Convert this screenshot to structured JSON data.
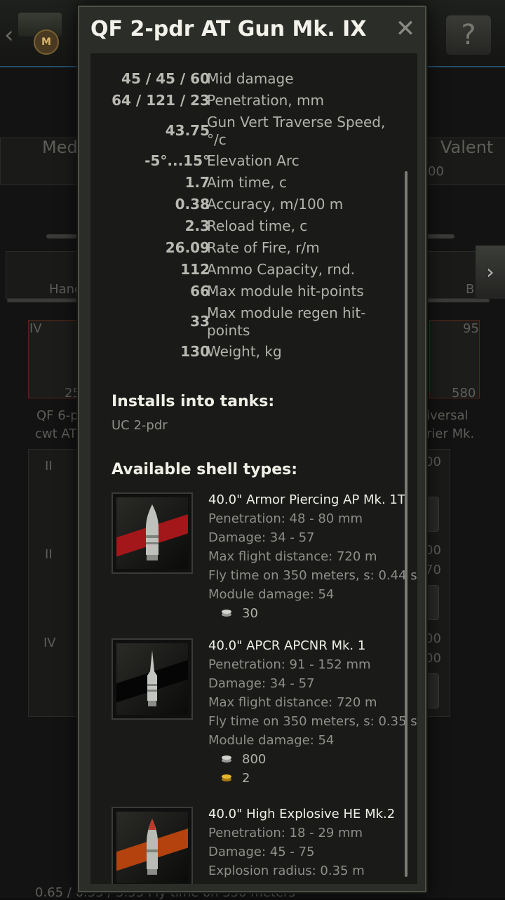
{
  "background": {
    "left_tab_label": "Med",
    "right_tab_label": "Valent",
    "right_tab_sub": "00",
    "hangar_label": "Hang",
    "right_menu_label": "B",
    "left_item_tier": "IV",
    "left_item_price": "25",
    "right_item_stars": "95",
    "right_item_price": "580",
    "left_item_name_1": "QF 6-p",
    "left_item_name_2": "cwt AT",
    "right_item_name_1": "iversal",
    "right_item_name_2": "rier Mk.",
    "row_tiers": [
      "II",
      "II",
      "IV"
    ],
    "right_nums": [
      "00",
      "00",
      "70",
      "00",
      "00"
    ],
    "bottom_text": "0.65 / 0.55 / 5.55   Fly time on 350 meters"
  },
  "dialog": {
    "title": "QF 2-pdr AT Gun Mk. IX",
    "close_icon": "close-x-icon",
    "stats": [
      {
        "value": "45 / 45 / 60",
        "label": "Mid damage"
      },
      {
        "value": "64 / 121 / 23",
        "label": "Penetration, mm"
      },
      {
        "value": "43.75",
        "label": "Gun Vert Traverse Speed, °/c"
      },
      {
        "value": "-5°...15°",
        "label": "Elevation Arc"
      },
      {
        "value": "1.7",
        "label": "Aim time, c"
      },
      {
        "value": "0.38",
        "label": "Accuracy, m/100 m"
      },
      {
        "value": "2.3",
        "label": "Reload time, c"
      },
      {
        "value": "26.09",
        "label": "Rate of Fire, r/m"
      },
      {
        "value": "112",
        "label": "Ammo Capacity, rnd."
      },
      {
        "value": "66",
        "label": "Max module hit-points"
      },
      {
        "value": "33",
        "label": "Max module regen hit-points"
      },
      {
        "value": "130",
        "label": "Weight, kg"
      }
    ],
    "installs_heading": "Installs into tanks:",
    "installs_tank": "UC 2-pdr",
    "shells_heading": "Available shell types:",
    "shells": [
      {
        "name": "40.0\" Armor Piercing AP Mk. 1T",
        "lines": [
          "Penetration: 48 - 80 mm",
          "Damage: 34 - 57",
          "Max flight distance: 720 m",
          "Fly time on 350 meters, s: 0.44 s",
          "Module damage: 54"
        ],
        "silver_price": "30",
        "stripe_color": "#a3161a"
      },
      {
        "name": "40.0\" APCR APCNR Mk. 1",
        "lines": [
          "Penetration: 91 - 152 mm",
          "Damage: 34 - 57",
          "Max flight distance: 720 m",
          "Fly time on 350 meters, s: 0.35 s",
          "Module damage: 54"
        ],
        "silver_price": "800",
        "gold_price": "2",
        "stripe_color": "#050505"
      },
      {
        "name": "40.0\" High Explosive HE Mk.2",
        "lines": [
          "Penetration: 18 - 29 mm",
          "Damage: 45 - 75",
          "Explosion radius: 0.35 m"
        ],
        "stripe_color": "#b3420f"
      }
    ]
  }
}
